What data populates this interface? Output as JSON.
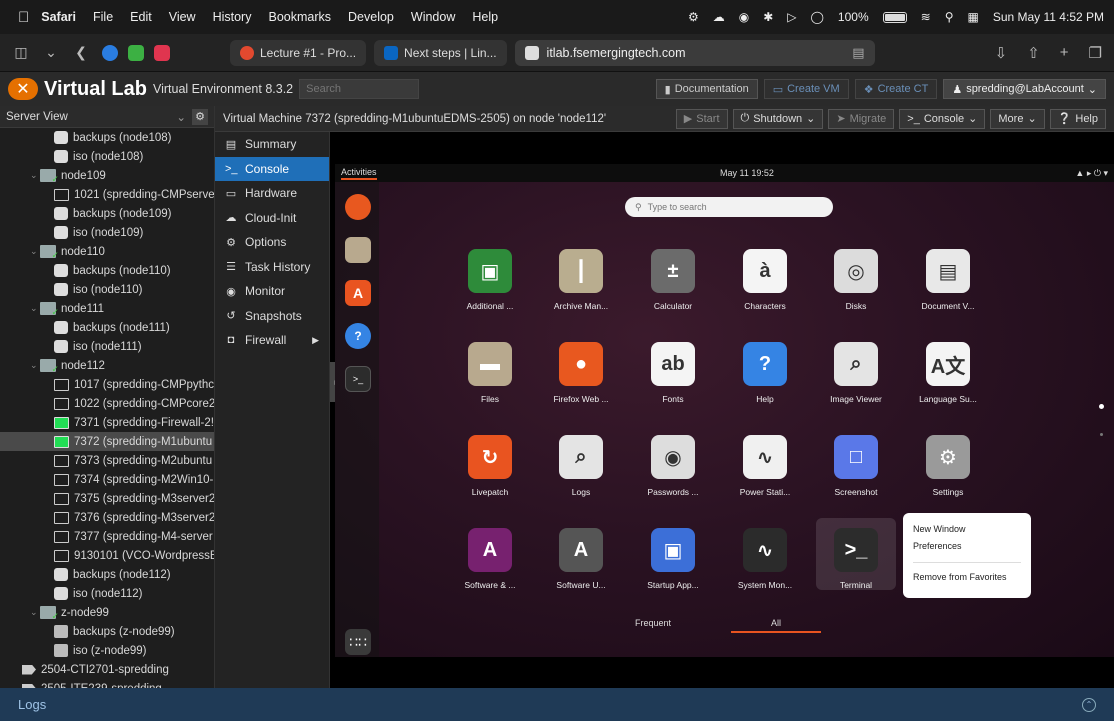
{
  "menubar": {
    "app": "Safari",
    "items": [
      "File",
      "Edit",
      "View",
      "History",
      "Bookmarks",
      "Develop",
      "Window",
      "Help"
    ],
    "battery": "100%",
    "datetime": "Sun May 11  4:52 PM"
  },
  "safari": {
    "tabs": [
      {
        "label": "Lecture #1 - Pro...",
        "color": "#e2492f"
      },
      {
        "label": "Next steps | Lin...",
        "color": "#0a66c2"
      }
    ],
    "address": "itlab.fsemergingtech.com"
  },
  "pve": {
    "brand": "Virtual Lab",
    "subtitle": "Virtual Environment 8.3.2",
    "search_placeholder": "Search",
    "buttons": {
      "documentation": "Documentation",
      "create_vm": "Create VM",
      "create_ct": "Create CT",
      "user": "spredding@LabAccount"
    }
  },
  "tree": {
    "view": "Server View",
    "nodes": [
      {
        "label": "backups (node108)",
        "icon": "storage",
        "indent": 2
      },
      {
        "label": "iso (node108)",
        "icon": "storage",
        "indent": 2
      },
      {
        "label": "node109",
        "icon": "server",
        "indent": 1
      },
      {
        "label": "1021 (spredding-CMPserve",
        "icon": "vm",
        "indent": 2
      },
      {
        "label": "backups (node109)",
        "icon": "storage",
        "indent": 2
      },
      {
        "label": "iso (node109)",
        "icon": "storage",
        "indent": 2
      },
      {
        "label": "node110",
        "icon": "server",
        "indent": 1
      },
      {
        "label": "backups (node110)",
        "icon": "storage",
        "indent": 2
      },
      {
        "label": "iso (node110)",
        "icon": "storage",
        "indent": 2
      },
      {
        "label": "node111",
        "icon": "server",
        "indent": 1
      },
      {
        "label": "backups (node111)",
        "icon": "storage",
        "indent": 2
      },
      {
        "label": "iso (node111)",
        "icon": "storage",
        "indent": 2
      },
      {
        "label": "node112",
        "icon": "server",
        "indent": 1
      },
      {
        "label": "1017 (spredding-CMPpythc",
        "icon": "vm",
        "indent": 2
      },
      {
        "label": "1022 (spredding-CMPcore2",
        "icon": "vm",
        "indent": 2
      },
      {
        "label": "7371 (spredding-Firewall-2!",
        "icon": "vm-run",
        "indent": 2
      },
      {
        "label": "7372 (spredding-M1ubuntu",
        "icon": "vm-run",
        "indent": 2,
        "selected": true
      },
      {
        "label": "7373 (spredding-M2ubuntu",
        "icon": "vm",
        "indent": 2
      },
      {
        "label": "7374 (spredding-M2Win10-",
        "icon": "vm",
        "indent": 2
      },
      {
        "label": "7375 (spredding-M3server2",
        "icon": "vm",
        "indent": 2
      },
      {
        "label": "7376 (spredding-M3server2",
        "icon": "vm",
        "indent": 2
      },
      {
        "label": "7377 (spredding-M4-server",
        "icon": "vm",
        "indent": 2
      },
      {
        "label": "9130101 (VCO-WordpressE",
        "icon": "template",
        "indent": 2
      },
      {
        "label": "backups (node112)",
        "icon": "storage",
        "indent": 2
      },
      {
        "label": "iso (node112)",
        "icon": "storage",
        "indent": 2
      },
      {
        "label": "z-node99",
        "icon": "server",
        "indent": 1
      },
      {
        "label": "backups (z-node99)",
        "icon": "storage-off",
        "indent": 2
      },
      {
        "label": "iso (z-node99)",
        "icon": "storage-off",
        "indent": 2
      },
      {
        "label": "2504-CTI2701-spredding",
        "icon": "tag",
        "indent": 1
      },
      {
        "label": "2505-ITE239-spredding",
        "icon": "tag",
        "indent": 1
      }
    ]
  },
  "vm": {
    "title": "Virtual Machine 7372 (spredding-M1ubuntuEDMS-2505) on node 'node112'",
    "buttons": {
      "start": "Start",
      "shutdown": "Shutdown",
      "migrate": "Migrate",
      "console": "Console",
      "more": "More",
      "help": "Help"
    },
    "menu": [
      {
        "label": "Summary",
        "icon": "▤"
      },
      {
        "label": "Console",
        "icon": ">_",
        "active": true
      },
      {
        "label": "Hardware",
        "icon": "▭"
      },
      {
        "label": "Cloud-Init",
        "icon": "☁"
      },
      {
        "label": "Options",
        "icon": "⚙"
      },
      {
        "label": "Task History",
        "icon": "☰"
      },
      {
        "label": "Monitor",
        "icon": "◉"
      },
      {
        "label": "Snapshots",
        "icon": "↺"
      },
      {
        "label": "Firewall",
        "icon": "◘",
        "submenu": true
      }
    ]
  },
  "guest": {
    "activities": "Activities",
    "clock": "May 11  19:52",
    "search_placeholder": "Type to search",
    "apps": [
      {
        "label": "Additional ...",
        "color": "#2e8b3a",
        "glyph": "▣"
      },
      {
        "label": "Archive Man...",
        "color": "#b9ad8f",
        "glyph": "┃"
      },
      {
        "label": "Calculator",
        "color": "#6b6b6b",
        "glyph": "±"
      },
      {
        "label": "Characters",
        "color": "#f4f4f4",
        "glyph": "à"
      },
      {
        "label": "Disks",
        "color": "#dcdcdc",
        "glyph": "◎"
      },
      {
        "label": "Document V...",
        "color": "#e8e8e8",
        "glyph": "▤"
      },
      {
        "label": "Files",
        "color": "#b8a98e",
        "glyph": "▬"
      },
      {
        "label": "Firefox Web ...",
        "color": "#e8581f",
        "glyph": "●"
      },
      {
        "label": "Fonts",
        "color": "#f4f4f4",
        "glyph": "ab"
      },
      {
        "label": "Help",
        "color": "#3584e4",
        "glyph": "?"
      },
      {
        "label": "Image Viewer",
        "color": "#e4e4e4",
        "glyph": "⌕"
      },
      {
        "label": "Language Su...",
        "color": "#f4f4f4",
        "glyph": "A文"
      },
      {
        "label": "Livepatch",
        "color": "#e95420",
        "glyph": "↻"
      },
      {
        "label": "Logs",
        "color": "#e4e4e4",
        "glyph": "⌕"
      },
      {
        "label": "Passwords ...",
        "color": "#ddd",
        "glyph": "◉"
      },
      {
        "label": "Power Stati...",
        "color": "#f0f0f0",
        "glyph": "∿"
      },
      {
        "label": "Screenshot",
        "color": "#5a78e8",
        "glyph": "□"
      },
      {
        "label": "Settings",
        "color": "#9a9a9a",
        "glyph": "⚙"
      },
      {
        "label": "Software & ...",
        "color": "#77216f",
        "glyph": "A"
      },
      {
        "label": "Software U...",
        "color": "#555",
        "glyph": "A"
      },
      {
        "label": "Startup App...",
        "color": "#3c6fd8",
        "glyph": "▣"
      },
      {
        "label": "System Mon...",
        "color": "#2b2b2b",
        "glyph": "∿"
      },
      {
        "label": "Terminal",
        "color": "#2c2c2c",
        "glyph": ">_",
        "highlighted": true
      }
    ],
    "context_menu": {
      "new_window": "New Window",
      "preferences": "Preferences",
      "remove": "Remove from Favorites"
    },
    "tabs": {
      "frequent": "Frequent",
      "all": "All"
    }
  },
  "logs": "Logs"
}
